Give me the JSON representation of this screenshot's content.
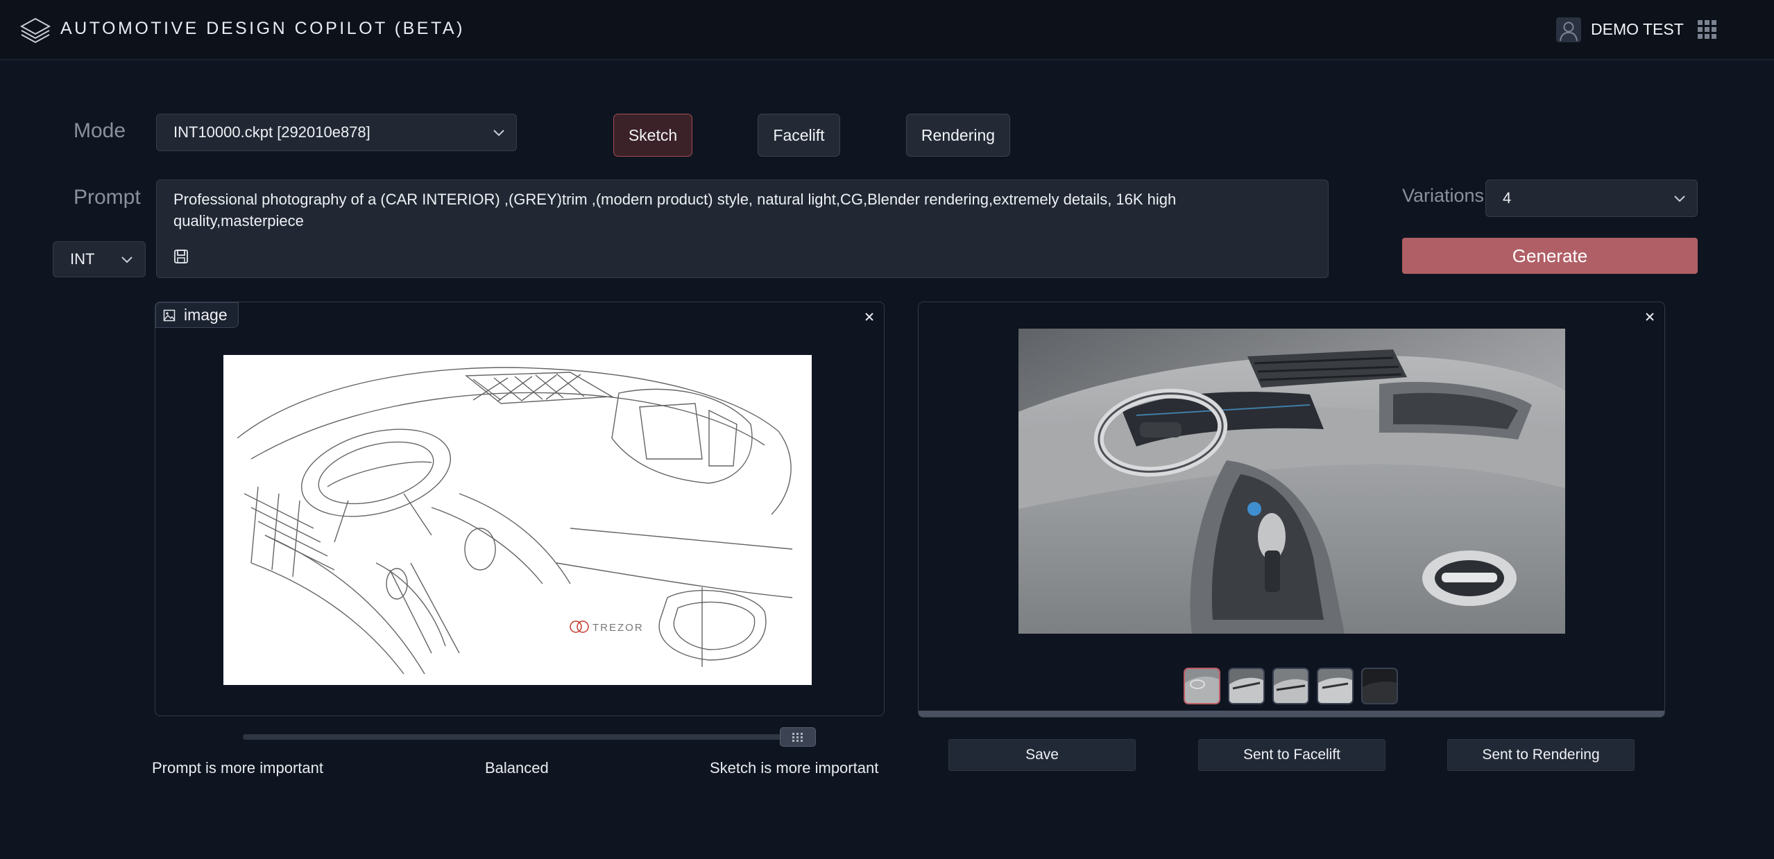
{
  "header": {
    "title": "AUTOMOTIVE DESIGN COPILOT (BETA)",
    "user_name": "DEMO TEST",
    "icons": [
      "layers-logo-icon",
      "user-avatar-icon",
      "apps-grid-icon"
    ]
  },
  "mode": {
    "label": "Mode",
    "model_value": "INT10000.ckpt [292010e878]",
    "buttons": [
      {
        "label": "Sketch",
        "active": true
      },
      {
        "label": "Facelift",
        "active": false
      },
      {
        "label": "Rendering",
        "active": false
      }
    ]
  },
  "prompt": {
    "label": "Prompt",
    "category_value": "INT",
    "text": "Professional photography of a (CAR INTERIOR)  ,(GREY)trim ,(modern product) style, natural light,CG,Blender rendering,extremely details, 16K high quality,masterpiece"
  },
  "variations": {
    "label": "Variations",
    "value": "4"
  },
  "generate_label": "Generate",
  "input_panel": {
    "tag": "image",
    "sketch_brand": "TREZOR"
  },
  "output_panel": {
    "thumbnail_count": 5,
    "selected_thumbnail": 1
  },
  "slider": {
    "left_label": "Prompt is more important",
    "middle_label": "Balanced",
    "right_label": "Sketch is more important",
    "position": 1.0
  },
  "actions": {
    "save": "Save",
    "facelift": "Sent to Facelift",
    "rendering": "Sent to Rendering"
  },
  "colors": {
    "background": "#0f1520",
    "accent": "#b05f66",
    "active_border": "#a44c55"
  }
}
